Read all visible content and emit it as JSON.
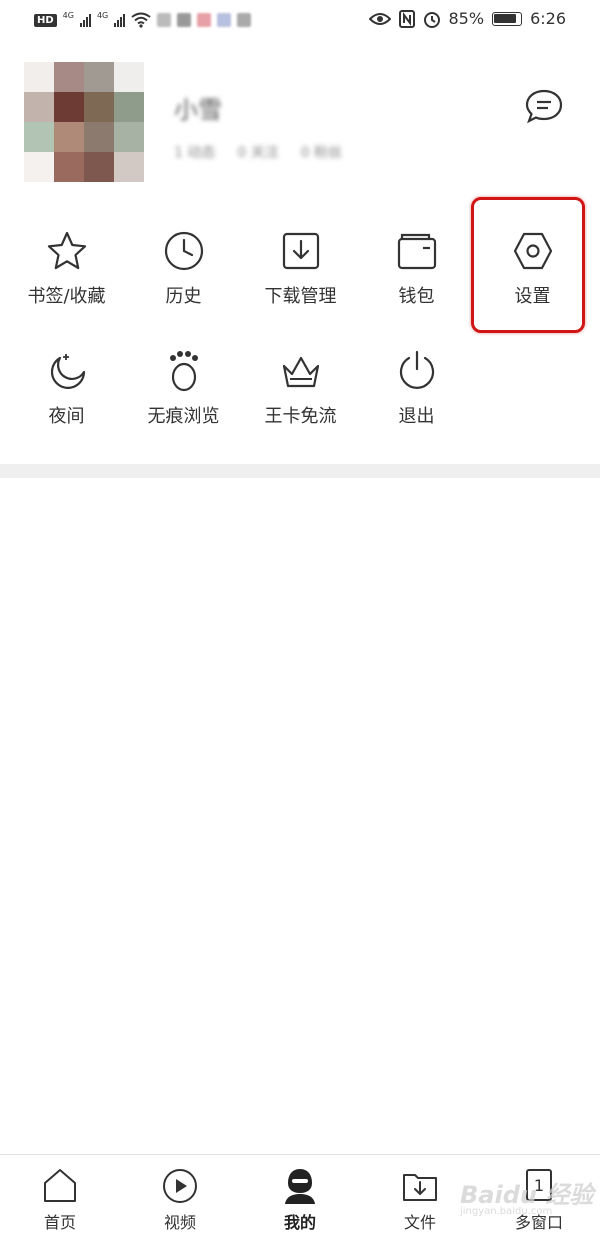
{
  "status_bar": {
    "hd": "HD",
    "sig1": "4G",
    "sig2": "4G",
    "battery_pct": "85%",
    "time": "6:26"
  },
  "profile": {
    "username": "小雪",
    "stats": [
      "1 动态",
      "0 关注",
      "0 粉丝"
    ],
    "avatar_colors": [
      "#f2eeeb",
      "#a78a86",
      "#a09a93",
      "#f0eeec",
      "#c2b3ac",
      "#6e3a34",
      "#7e6a54",
      "#8f9c8c",
      "#b2c4b4",
      "#b08a78",
      "#8c7a6e",
      "#a8b2a4",
      "#f4f1ee",
      "#9a6a5e",
      "#7e574f",
      "#d2c9c4"
    ]
  },
  "menu": {
    "row1": [
      {
        "label": "书签/收藏",
        "icon": "star-icon"
      },
      {
        "label": "历史",
        "icon": "clock-icon"
      },
      {
        "label": "下载管理",
        "icon": "download-icon"
      },
      {
        "label": "钱包",
        "icon": "wallet-icon"
      },
      {
        "label": "设置",
        "icon": "settings-hexagon-icon"
      }
    ],
    "row2": [
      {
        "label": "夜间",
        "icon": "moon-icon"
      },
      {
        "label": "无痕浏览",
        "icon": "paw-icon"
      },
      {
        "label": "王卡免流",
        "icon": "crown-icon"
      },
      {
        "label": "退出",
        "icon": "power-icon"
      }
    ]
  },
  "bottom_nav": [
    {
      "label": "首页",
      "icon": "home-icon"
    },
    {
      "label": "视频",
      "icon": "play-icon"
    },
    {
      "label": "我的",
      "icon": "user-icon"
    },
    {
      "label": "文件",
      "icon": "folder-icon"
    },
    {
      "label": "多窗口",
      "icon": "windows-icon",
      "count": "1"
    }
  ],
  "colors": {
    "accent_highlight": "#d01515",
    "text": "#333333",
    "divider": "#efefef"
  }
}
